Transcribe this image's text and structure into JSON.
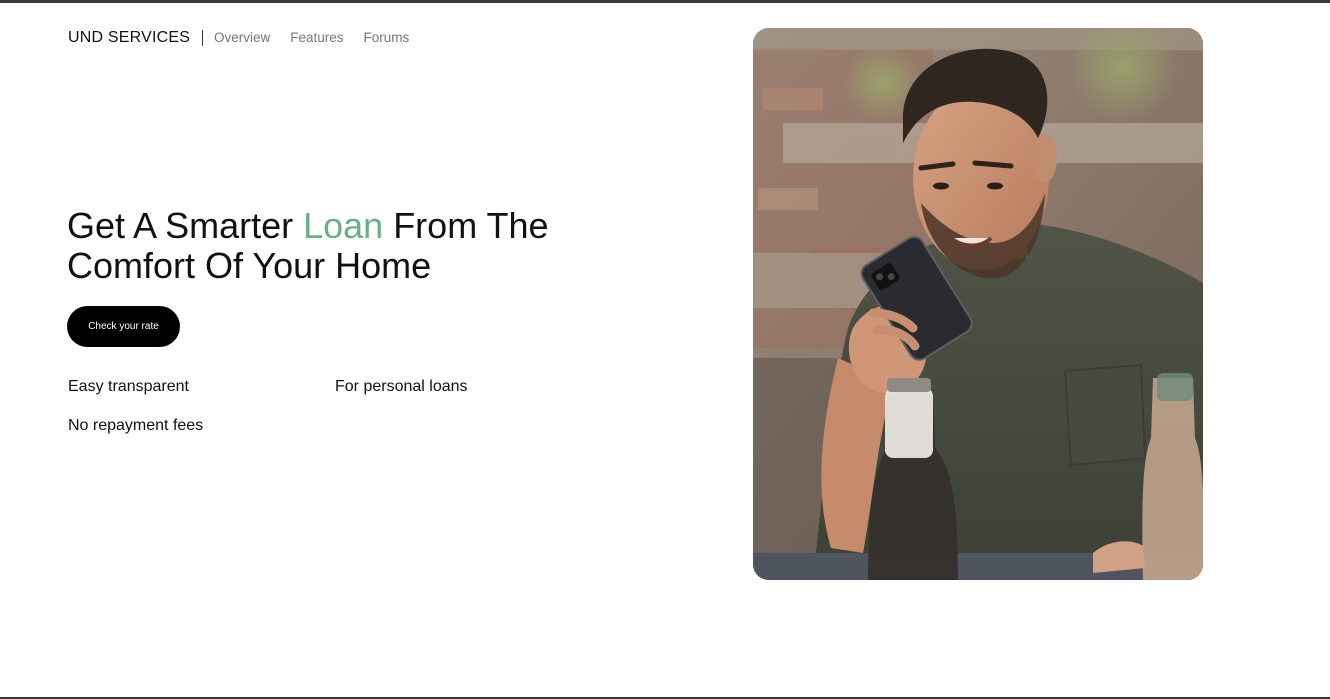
{
  "header": {
    "brand": "UND SERVICES",
    "nav": [
      {
        "label": "Overview"
      },
      {
        "label": "Features"
      },
      {
        "label": "Forums"
      }
    ]
  },
  "hero": {
    "title_before": "Get A Smarter ",
    "title_accent": "Loan",
    "title_after": " From The Comfort Of Your Home",
    "cta_label": "Check your rate",
    "features": [
      "Easy transparent",
      "For personal loans",
      "No repayment fees"
    ]
  },
  "colors": {
    "accent": "#6aae87",
    "cta_background": "#000000",
    "nav_text": "#777777"
  },
  "image": {
    "subject": "man-talking-on-phone-photo"
  }
}
